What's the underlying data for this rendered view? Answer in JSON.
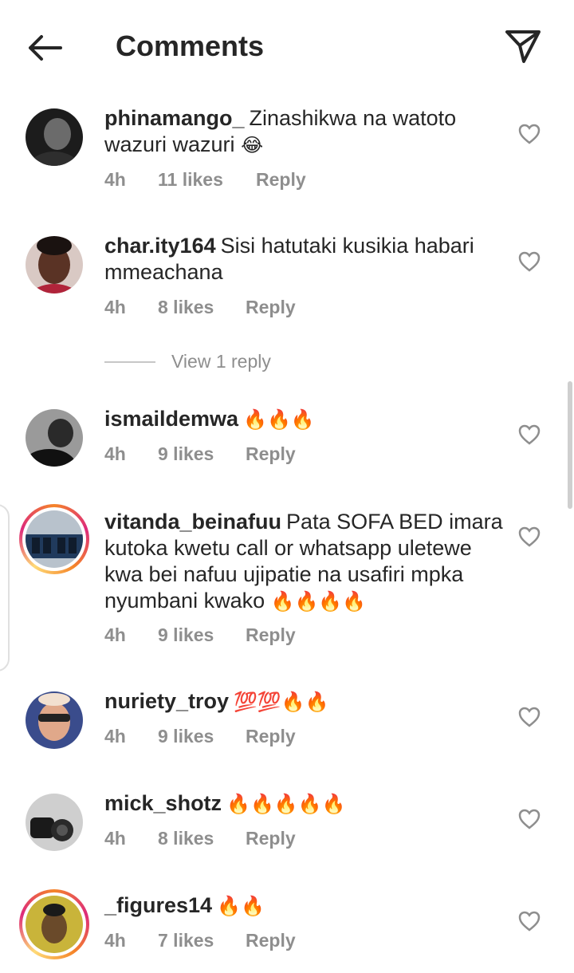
{
  "header": {
    "title": "Comments",
    "back_icon": "arrow-left-icon",
    "share_icon": "paper-plane-icon"
  },
  "view_replies_label": "View 1 reply",
  "comments": [
    {
      "username": "phinamango_",
      "text": "Zinashikwa na watoto wazuri wazuri",
      "emoji": "😂",
      "time": "4h",
      "likes": "11 likes",
      "reply": "Reply"
    },
    {
      "username": "char.ity164",
      "text": "Sisi hatutaki kusikia habari mmeachana",
      "emoji": "",
      "time": "4h",
      "likes": "8 likes",
      "reply": "Reply"
    },
    {
      "username": "ismaildemwa",
      "text": "",
      "emoji": "🔥🔥🔥",
      "time": "4h",
      "likes": "9 likes",
      "reply": "Reply"
    },
    {
      "username": "vitanda_beinafuu",
      "text": "Pata SOFA BED imara kutoka kwetu call or whatsapp uletewe kwa bei nafuu ujipatie na usafiri mpka nyumbani kwako",
      "emoji": "🔥🔥🔥🔥",
      "time": "4h",
      "likes": "9 likes",
      "reply": "Reply"
    },
    {
      "username": "nuriety_troy",
      "text": "",
      "emoji": "💯💯🔥🔥",
      "time": "4h",
      "likes": "9 likes",
      "reply": "Reply"
    },
    {
      "username": "mick_shotz",
      "text": "",
      "emoji": "🔥🔥🔥🔥🔥",
      "time": "4h",
      "likes": "8 likes",
      "reply": "Reply"
    },
    {
      "username": "_figures14",
      "text": "",
      "emoji": "🔥🔥",
      "time": "4h",
      "likes": "7 likes",
      "reply": "Reply"
    }
  ]
}
